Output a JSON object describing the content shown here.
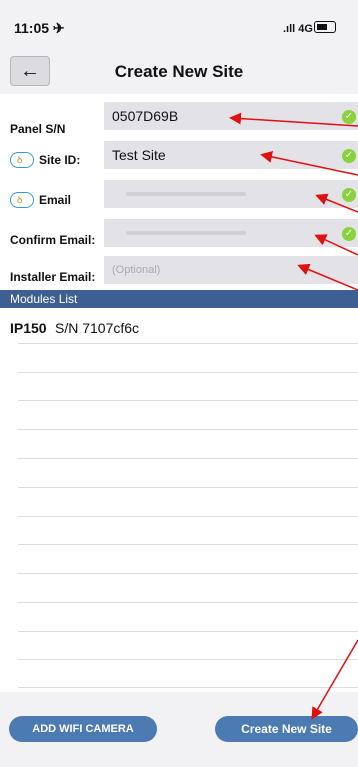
{
  "status": {
    "time": "11:05 ✈",
    "network": "4G"
  },
  "nav": {
    "title": "Create New Site",
    "back_icon": "back-arrow-icon"
  },
  "form": {
    "panel_sn_label": "Panel S/N",
    "panel_sn_value": "0507D69B",
    "site_id_label": "Site ID:",
    "site_id_value": "Test Site",
    "email_label": "Email",
    "confirm_email_label": "Confirm Email:",
    "installer_email_label": "Installer Email:",
    "installer_email_placeholder": "(Optional)"
  },
  "modules": {
    "header": "Modules List",
    "items": [
      {
        "type": "IP150",
        "sn": "S/N 7107cf6c"
      }
    ]
  },
  "buttons": {
    "add_camera": "ADD WIFI CAMERA",
    "create_site": "Create New Site"
  },
  "colors": {
    "accent": "#4c7ab2",
    "header": "#3d5f91",
    "check": "#88d33b",
    "annotation_arrow": "#e01010"
  }
}
